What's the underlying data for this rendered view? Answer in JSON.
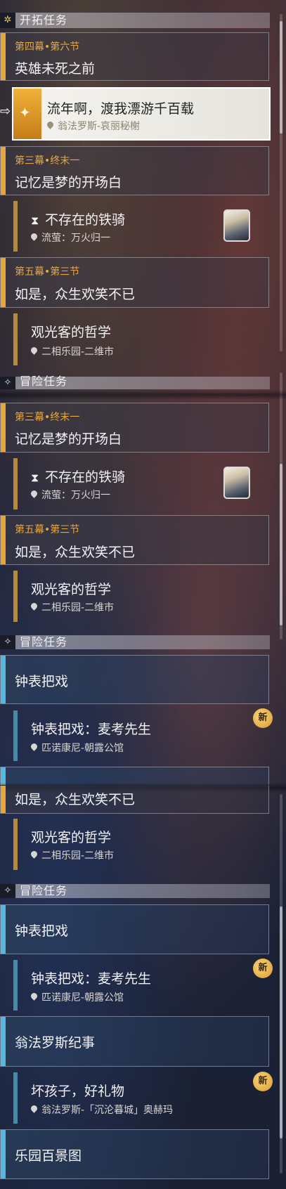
{
  "sections": {
    "trailblaze": "开拓任务",
    "adventure": "冒险任务"
  },
  "icons": {
    "trailblaze": "sun-icon",
    "adventure": "diamond-icon",
    "pin": "location-pin-icon",
    "hourglass": "hourglass-icon",
    "new_badge": "new-badge"
  },
  "colors": {
    "trailblaze_accent": "#e8a63a",
    "adventure_accent": "#55b8dc",
    "new_badge": "#f0b848"
  },
  "quests": {
    "act4_6": {
      "tag": "第四幕•第六节",
      "title": "英雄未死之前"
    },
    "selected": {
      "title": "流年啊，渡我漂游千百载",
      "location": "翁法罗斯-哀丽秘榭"
    },
    "act3_end": {
      "tag": "第三幕•终末一",
      "title": "记忆是梦的开场白"
    },
    "knight": {
      "title": "不存在的铁骑",
      "location": "流萤：万火归一"
    },
    "act5_3": {
      "tag": "第五幕•第三节",
      "title": "如是，众生欢笑不已"
    },
    "tourist": {
      "title": "观光客的哲学",
      "location": "二相乐园-二维市"
    },
    "clock": {
      "title": "钟表把戏"
    },
    "clock_sub": {
      "title": "钟表把戏：麦考先生",
      "location": "匹诺康尼-朝露公馆",
      "badge": "新"
    },
    "okhema": {
      "title": "翁法罗斯纪事"
    },
    "badkid": {
      "title": "坏孩子，好礼物",
      "location": "翁法罗斯-「沉沦暮城」奥赫玛",
      "badge": "新"
    },
    "paradise": {
      "title": "乐园百景图"
    }
  }
}
